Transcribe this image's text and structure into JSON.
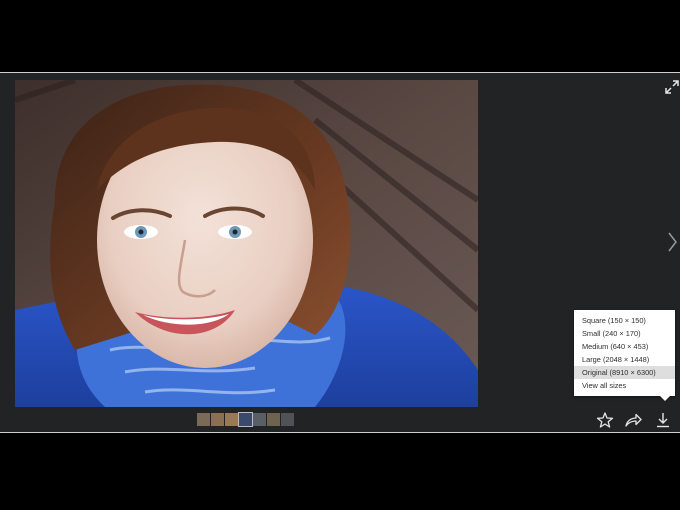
{
  "viewer": {
    "photo_alt": "Portrait of smiling woman with auburn hair and blue scarf"
  },
  "filmstrip": {
    "thumbnails": [
      {
        "color": "#7a6a58"
      },
      {
        "color": "#8a6f52"
      },
      {
        "color": "#9a7a55"
      },
      {
        "color": "#3b4a6a"
      },
      {
        "color": "#5a5f66"
      },
      {
        "color": "#6d6350"
      },
      {
        "color": "#4f5356"
      }
    ],
    "active_index": 3
  },
  "download_menu": {
    "items": [
      {
        "label": "Square (150 × 150)"
      },
      {
        "label": "Small (240 × 170)"
      },
      {
        "label": "Medium (640 × 453)"
      },
      {
        "label": "Large (2048 × 1448)"
      },
      {
        "label": "Original (8910 × 6300)"
      },
      {
        "label": "View all sizes"
      }
    ],
    "selected_index": 4
  },
  "actions": {
    "favorite_icon": "star-icon",
    "share_icon": "share-icon",
    "download_icon": "download-icon"
  },
  "colors": {
    "viewer_bg": "#222325",
    "page_bg": "#000000",
    "menu_bg": "#ffffff",
    "menu_selected": "#dedede",
    "icon": "#e6e6e6"
  }
}
